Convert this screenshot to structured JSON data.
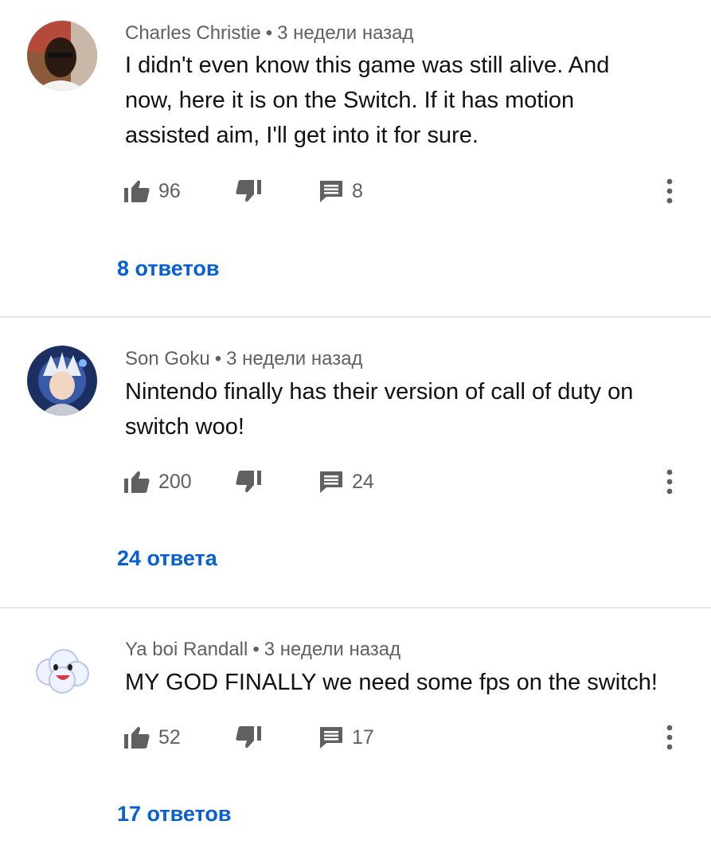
{
  "comments": [
    {
      "author": "Charles Christie",
      "separator": "•",
      "time": "3 недели назад",
      "text_lines": [
        "I didn't even know this game was still alive. And",
        "now, here it is on the Switch. If it has motion",
        "assisted aim, I'll get into it for sure."
      ],
      "likes": "96",
      "reply_count": "8",
      "replies_label": "8 ответов",
      "avatar": "person-photo"
    },
    {
      "author": "Son Goku",
      "separator": "•",
      "time": "3 недели назад",
      "text_lines": [
        "Nintendo finally has their version of call of duty on",
        "switch woo!"
      ],
      "likes": "200",
      "reply_count": "24",
      "replies_label": "24 ответа",
      "avatar": "anime-character"
    },
    {
      "author": "Ya boi Randall",
      "separator": "•",
      "time": "3 недели назад",
      "text_lines": [
        "MY GOD FINALLY we need some fps on the switch!"
      ],
      "likes": "52",
      "reply_count": "17",
      "replies_label": "17 ответов",
      "avatar": "cloud-face"
    }
  ],
  "icons": {
    "like": "thumbs-up-icon",
    "dislike": "thumbs-down-icon",
    "reply": "comment-icon",
    "more": "more-vertical-icon"
  },
  "colors": {
    "link": "#065fd4",
    "meta": "#606060",
    "icon": "#606060",
    "divider": "#e5e5e5"
  }
}
